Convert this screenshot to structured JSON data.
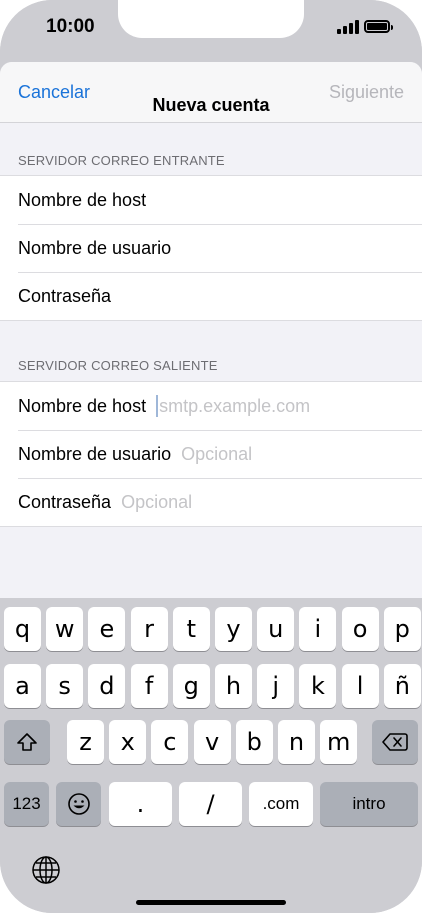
{
  "status_bar": {
    "time": "10:00"
  },
  "navbar": {
    "cancel": "Cancelar",
    "title": "Nueva cuenta",
    "next": "Siguiente"
  },
  "incoming": {
    "header": "SERVIDOR CORREO ENTRANTE",
    "rows": [
      {
        "label": "Nombre de host"
      },
      {
        "label": "Nombre de usuario"
      },
      {
        "label": "Contraseña"
      }
    ]
  },
  "outgoing": {
    "header": "SERVIDOR CORREO SALIENTE",
    "rows": [
      {
        "label": "Nombre de host",
        "placeholder": "smtp.example.com"
      },
      {
        "label": "Nombre de usuario",
        "placeholder": "Opcional"
      },
      {
        "label": "Contraseña",
        "placeholder": "Opcional"
      }
    ]
  },
  "keyboard": {
    "row1": [
      "q",
      "w",
      "e",
      "r",
      "t",
      "y",
      "u",
      "i",
      "o",
      "p"
    ],
    "row2": [
      "a",
      "s",
      "d",
      "f",
      "g",
      "h",
      "j",
      "k",
      "l",
      "ñ"
    ],
    "row3": [
      "z",
      "x",
      "c",
      "v",
      "b",
      "n",
      "m"
    ],
    "numbers": "123",
    "dot": ".",
    "slash": "/",
    "dotcom": ".com",
    "return": "intro",
    "icons": {
      "shift": "shift-icon",
      "delete": "delete-icon",
      "emoji": "emoji-icon",
      "globe": "globe-icon"
    }
  }
}
